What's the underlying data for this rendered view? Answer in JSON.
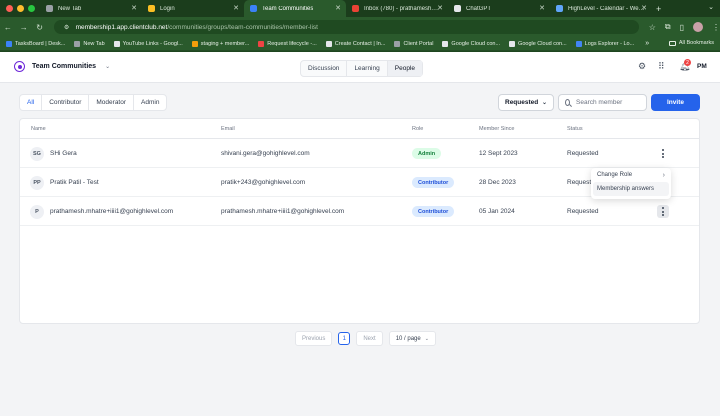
{
  "browser": {
    "tabs": [
      {
        "title": "New Tab",
        "favicon_color": "#9aa0a6"
      },
      {
        "title": "Login",
        "favicon_color": "#fbbf24"
      },
      {
        "title": "Team Communities",
        "favicon_color": "#3b82f6"
      },
      {
        "title": "Inbox (780) - prathamesh.mhatre...",
        "favicon_color": "#ea4335"
      },
      {
        "title": "ChatGPT",
        "favicon_color": "#e5e7eb"
      },
      {
        "title": "HighLevel - Calendar - Week...",
        "favicon_color": "#60a5fa"
      }
    ],
    "url_host": "membership1.app.clientclub.net",
    "url_path": "/communities/groups/team-communities/member-list",
    "bookmarks": [
      {
        "label": "TasksBoard | Desk...",
        "color": "#3b82f6"
      },
      {
        "label": "New Tab",
        "color": "#9aa0a6"
      },
      {
        "label": "YouTube Links - Googl...",
        "color": "#e5e7eb"
      },
      {
        "label": "staging + member...",
        "color": "#f59e0b"
      },
      {
        "label": "Request lifecycle -...",
        "color": "#ef4444"
      },
      {
        "label": "Create Contact | In...",
        "color": "#e5e7eb"
      },
      {
        "label": "Client Portal",
        "color": "#9aa0a6"
      },
      {
        "label": "Google Cloud con...",
        "color": "#e5e7eb"
      },
      {
        "label": "Google Cloud con...",
        "color": "#e5e7eb"
      },
      {
        "label": "Logs Explorer - Lo...",
        "color": "#4285f4"
      }
    ],
    "bookmarks_more": "»",
    "all_bookmarks": "All Bookmarks"
  },
  "header": {
    "community_name": "Team Communities",
    "nav_tabs": [
      "Discussion",
      "Learning",
      "People"
    ],
    "active_tab": "People",
    "notification_count": "2",
    "user_initials": "PM"
  },
  "filters": {
    "roles": [
      "All",
      "Contributor",
      "Moderator",
      "Admin"
    ],
    "active_role": "All",
    "status_value": "Requested",
    "search_placeholder": "Search member",
    "invite_label": "Invite"
  },
  "table": {
    "columns": [
      "Name",
      "Email",
      "Role",
      "Member Since",
      "Status"
    ],
    "rows": [
      {
        "initials": "SG",
        "name": "SHi Gera",
        "email": "shivani.gera@gohighlevel.com",
        "role": "Admin",
        "since": "12 Sept 2023",
        "status": "Requested"
      },
      {
        "initials": "PP",
        "name": "Pratik Patil - Test",
        "email": "pratik+243@gohighlevel.com",
        "role": "Contributor",
        "since": "28 Dec 2023",
        "status": "Requested"
      },
      {
        "initials": "P",
        "name": "prathamesh.mhatre+iiii1@gohighlevel.com",
        "email": "prathamesh.mhatre+iiii1@gohighlevel.com",
        "role": "Contributor",
        "since": "05 Jan 2024",
        "status": "Requested"
      }
    ]
  },
  "row_menu": {
    "items": [
      "Change Role",
      "Membership answers"
    ]
  },
  "pagination": {
    "previous": "Previous",
    "current_page": "1",
    "next": "Next",
    "page_size": "10 / page"
  },
  "colors": {
    "primary": "#2563eb",
    "brand": "#6d28d9",
    "admin_badge": "#15803d",
    "contributor_badge": "#1d4ed8"
  }
}
